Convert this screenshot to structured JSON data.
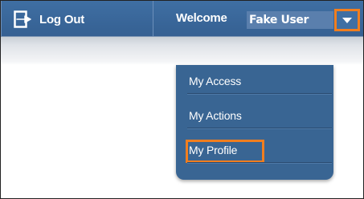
{
  "header": {
    "logout_label": "Log Out",
    "welcome_label": "Welcome",
    "username": "Fake User",
    "logout_icon": "logout-icon",
    "dropdown_icon": "chevron-down-icon"
  },
  "menu": {
    "items": [
      {
        "label": "My Access"
      },
      {
        "label": "My Actions"
      },
      {
        "label": "My Profile"
      }
    ]
  },
  "colors": {
    "header_blue": "#356092",
    "menu_blue": "#396593",
    "highlight_orange": "#f07e1f"
  }
}
